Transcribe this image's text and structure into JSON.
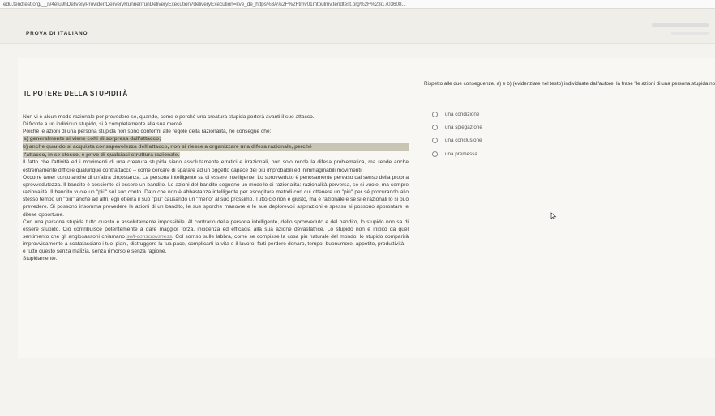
{
  "browser": {
    "url": "edu.tendtest.org/__n/4etu9hDeliveryProvider/DeliveryRunner/runDeliveryExecution?deliveryExecution=kve_de_https%3A%2F%2Ftmv01mtpulmv.tendtest.org%2F%23i1703608..."
  },
  "header": {
    "test_title": "PROVA DI ITALIANO"
  },
  "passage": {
    "title": "IL POTERE DELLA STUPIDITÀ",
    "lines": [
      "Non vi è alcun modo razionale per prevedere se, quando, come e perché una creatura stupida porterà avanti il suo attacco.",
      "Di fronte a un individuo stupido, si è completamente alla sua mercé.",
      "Poiché le azioni di una persona stupida non sono conformi alle regole della razionalità, ne consegue che:"
    ],
    "highlight_a": "a) generalmente si viene colti di sorpresa dall'attacco;",
    "highlight_b": "b) anche quando si acquista consapevolezza dell'attacco, non si riesce a organizzare una difesa razionale, perché",
    "highlight_b2": "l'attacco, in se stesso, è privo di qualsiasi struttura razionale.",
    "para1": "Il fatto che l'attività ed i movimenti di una creatura stupida siano assolutamente erratici e irrazionali, non solo rende la difesa problematica, ma rende anche estremamente difficile qualunque contrattacco – come cercare di sparare ad un oggetto capace dei più improbabili ed inimmaginabili movimenti.",
    "para2_a": "Occorre tener conto anche di un'altra circostanza. La persona intelligente sa di essere intelligente. Lo sprovveduto è penosamente pervaso dal senso della propria sprovvedutezza. Il bandito è cosciente di essere un bandito. Le azioni del bandito seguono un modello di razionalità: razionalità perversa, se si vuole, ma sempre razionalità. Il bandito vuole un \"più\" sul suo conto. Dato che non è abbastanza intelligente per escogitare metodi con cui ottenere un \"più\" per sé procurando allo stesso tempo un \"più\" anche ad altri, egli otterrà il suo \"più\" causando un \"meno\" al suo prossimo. Tutto ciò non è giusto, ma è razionale e se si è razionali lo si può prevedere. Si possono insomma prevedere le azioni di un bandito, le sue sporche manovre e le sue deplorevoli aspirazioni e spesso si possono approntare le difese opportune.",
    "para2_b": "Con una persona stupida tutto questo è assolutamente impossibile. Al contrario della persona intelligente, dello sprovveduto e del bandito, lo stupido non sa di essere stupido. Ciò contribuisce potentemente a dare maggior forza, incidenza ed efficacia alla sua azione devastatrice. Lo stupido non è inibito da quel sentimento che gli anglosassoni chiamano",
    "self_term": "self-consciousness",
    "para2_c": ". Col sorriso sulle labbra, come se compisse la cosa più naturale del mondo, lo stupido comparirà improvvisamente a scatafasciare i tuoi piani, distruggere la tua pace, complicarti la vita e il lavoro, farti perdere denaro, tempo, buonumore, appetito, produttività – e tutto questo senza malizia, senza rimorso e senza ragione.",
    "closing": "Stupidamente."
  },
  "question": {
    "text": "Rispetto alle due conseguenze, a) e b) (evidenziate nel testo) individuate dall'autore, la frase \"le azioni di una persona stupida non sono conformi alle regole della razionalità\" costituisce",
    "bold_line": "stupida non sono conformi alle regole della razionalità\" costituisce"
  },
  "options": [
    {
      "label": "una condizione"
    },
    {
      "label": "una spiegazione"
    },
    {
      "label": "una conclusione"
    },
    {
      "label": "una premessa"
    }
  ],
  "colors": {
    "highlight": "#c9c5b4",
    "background": "#f4f3ef"
  }
}
